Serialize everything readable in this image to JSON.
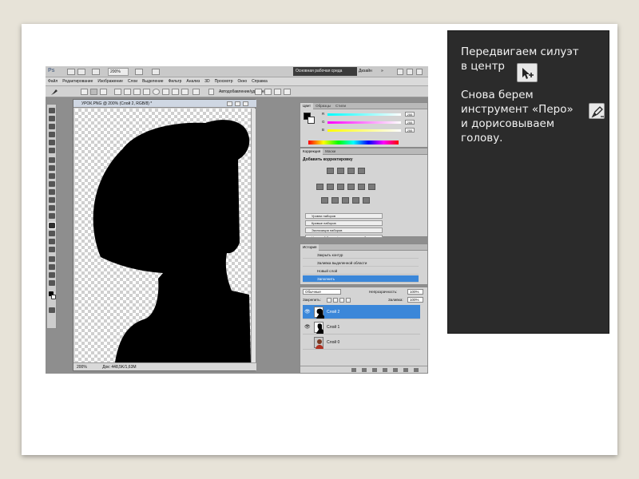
{
  "app": {
    "logo": "Ps",
    "zoom": "200%",
    "workspace": "Основная рабочая среда",
    "design": "Дизайн",
    "more": "»",
    "menu": [
      "Файл",
      "Редактирование",
      "Изображение",
      "Слои",
      "Выделение",
      "Фильтр",
      "Анализ",
      "3D",
      "Просмотр",
      "Окно",
      "Справка"
    ],
    "options_checkbox": "Автодобавление/удаление"
  },
  "document": {
    "title": "УРОК.PNG @ 200% (Слой 2, RGB/8) *",
    "status_zoom": "200%",
    "status_doc": "Док: 448,5K/1,63M"
  },
  "color_panel": {
    "tabs": [
      "Цвет",
      "Образцы",
      "Стили"
    ],
    "channels": [
      {
        "label": "R",
        "value": "255",
        "color": "#ff3030"
      },
      {
        "label": "G",
        "value": "255",
        "color": "#30c030"
      },
      {
        "label": "B",
        "value": "255",
        "color": "#3050ff"
      }
    ]
  },
  "adjustments_panel": {
    "tabs": [
      "Коррекция",
      "Маски"
    ],
    "title": "Добавить корректировку",
    "presets": [
      "Уровни наборов",
      "Кривые наборов",
      "Экспозиция наборов",
      "Цветовой баланс/корректировка наборов"
    ]
  },
  "history_panel": {
    "tabs": [
      "История"
    ],
    "items": [
      {
        "label": "Закрыть контур",
        "selected": false
      },
      {
        "label": "Заливка выделенной области",
        "selected": false
      },
      {
        "label": "Новый слой",
        "selected": false
      },
      {
        "label": "Заполнить",
        "selected": true
      }
    ]
  },
  "layers_panel": {
    "blend_mode": "Обычные",
    "opacity_label": "Непрозрачность:",
    "opacity": "100%",
    "lock_label": "Закрепить:",
    "fill_label": "Заливка:",
    "fill": "100%",
    "layers": [
      {
        "name": "Слой 2",
        "selected": true,
        "visible": true
      },
      {
        "name": "Слой 1",
        "selected": false,
        "visible": true
      },
      {
        "name": "Слой 0",
        "selected": false,
        "visible": false
      }
    ]
  },
  "instructions": {
    "line1": "Передвигаем силуэт",
    "line2": "в центр",
    "move_tool_icon": "move-tool-icon",
    "p2": [
      "Снова берем",
      "инструмент «Перо»",
      "и дорисовываем",
      "голову."
    ],
    "pen_tool_icon": "pen-tool-icon"
  }
}
